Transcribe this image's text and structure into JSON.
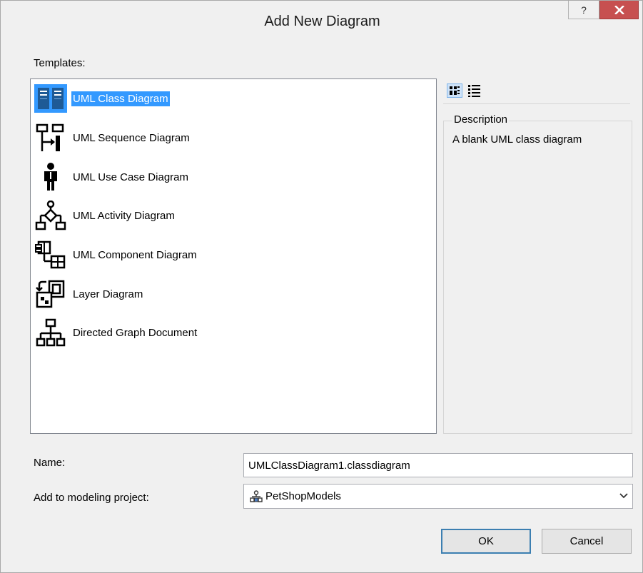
{
  "window": {
    "title": "Add New Diagram",
    "help_glyph": "?",
    "close_glyph": "X"
  },
  "templates": {
    "label": "Templates:",
    "items": [
      {
        "label": "UML Class Diagram",
        "icon": "uml-class-diagram-icon",
        "selected": true
      },
      {
        "label": "UML Sequence Diagram",
        "icon": "uml-sequence-diagram-icon"
      },
      {
        "label": "UML Use Case Diagram",
        "icon": "uml-use-case-diagram-icon"
      },
      {
        "label": "UML Activity Diagram",
        "icon": "uml-activity-diagram-icon"
      },
      {
        "label": "UML Component Diagram",
        "icon": "uml-component-diagram-icon"
      },
      {
        "label": "Layer Diagram",
        "icon": "layer-diagram-icon"
      },
      {
        "label": "Directed Graph Document",
        "icon": "directed-graph-icon"
      }
    ]
  },
  "view_buttons": {
    "icons": [
      "medium-icons-view-icon",
      "list-view-icon"
    ]
  },
  "description": {
    "legend": "Description",
    "text": "A blank UML class diagram"
  },
  "form": {
    "name_label": "Name:",
    "name_value": "UMLClassDiagram1.classdiagram",
    "project_label": "Add to modeling project:",
    "project_value": "PetShopModels",
    "project_icon": "modeling-project-icon"
  },
  "buttons": {
    "ok": "OK",
    "cancel": "Cancel"
  },
  "colors": {
    "selection": "#3399ff",
    "close_button": "#c75050",
    "icon_blue": "#1e5a96"
  }
}
